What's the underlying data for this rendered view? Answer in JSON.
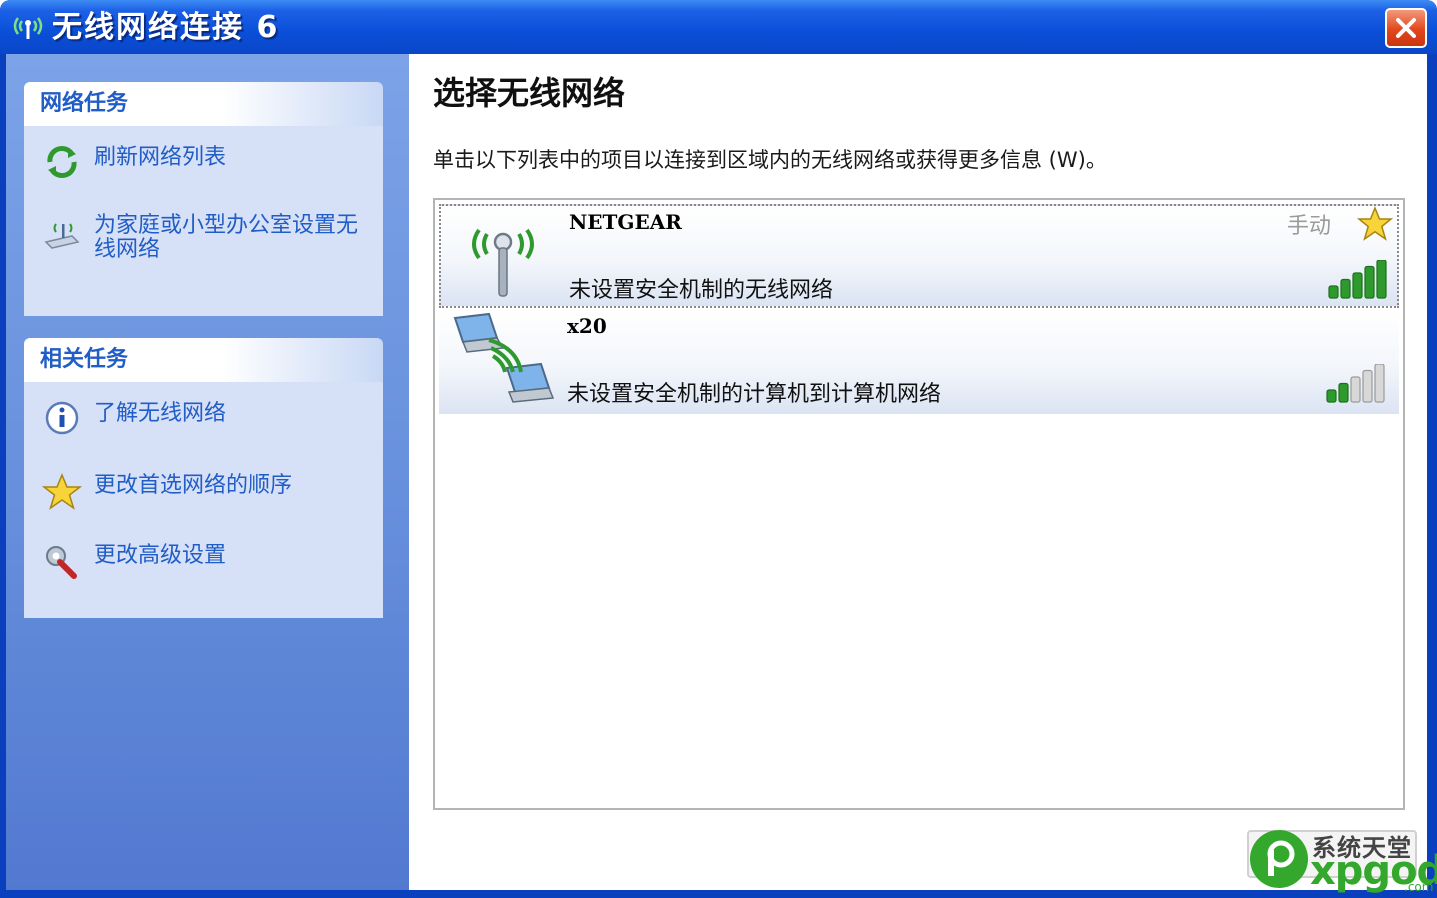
{
  "window": {
    "title": "无线网络连接 6"
  },
  "sidebar": {
    "network_tasks": {
      "header": "网络任务",
      "items": [
        {
          "label": "刷新网络列表",
          "icon": "refresh-icon"
        },
        {
          "label": "为家庭或小型办公室设置无线网络",
          "icon": "wireless-setup-icon"
        }
      ]
    },
    "related_tasks": {
      "header": "相关任务",
      "items": [
        {
          "label": "了解无线网络",
          "icon": "info-icon"
        },
        {
          "label": "更改首选网络的顺序",
          "icon": "star-icon"
        },
        {
          "label": "更改高级设置",
          "icon": "settings-icon"
        }
      ]
    }
  },
  "main": {
    "title": "选择无线网络",
    "instruction": "单击以下列表中的项目以连接到区域内的无线网络或获得更多信息 (W)。",
    "networks": [
      {
        "name": "NETGEAR",
        "description": "未设置安全机制的无线网络",
        "mode": "手动",
        "icon": "access-point-icon",
        "signal_bars": 5,
        "selected": true
      },
      {
        "name": "x20",
        "description": "未设置安全机制的计算机到计算机网络",
        "icon": "ad-hoc-network-icon",
        "signal_bars": 2,
        "selected": false
      }
    ]
  },
  "watermark": {
    "top": "系统天堂",
    "bottom": "xpgod",
    "suffix": ".com"
  },
  "colors": {
    "titlebar": "#0a4fd8",
    "task_pane": "#6a93de",
    "task_link": "#215dc6",
    "signal_on": "#2e9a2e",
    "signal_off": "#d8d8d8"
  }
}
